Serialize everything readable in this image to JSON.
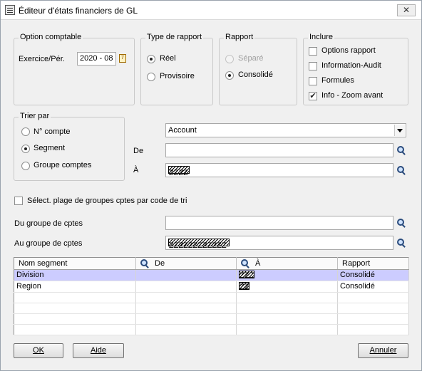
{
  "window": {
    "title": "Éditeur d'états financiers de GL",
    "close_glyph": "✕"
  },
  "option_comptable": {
    "legend": "Option comptable",
    "period_label": "Exercice/Pér.",
    "period_value": "2020 - 08"
  },
  "type_rapport": {
    "legend": "Type de rapport",
    "options": [
      {
        "label": "Réel",
        "checked": true
      },
      {
        "label": "Provisoire",
        "checked": false
      }
    ]
  },
  "rapport": {
    "legend": "Rapport",
    "options": [
      {
        "label": "Séparé",
        "checked": false,
        "disabled": true
      },
      {
        "label": "Consolidé",
        "checked": true,
        "disabled": false
      }
    ]
  },
  "inclure": {
    "legend": "Inclure",
    "options": [
      {
        "label": "Options rapport",
        "checked": false
      },
      {
        "label": "Information-Audit",
        "checked": false
      },
      {
        "label": "Formules",
        "checked": false
      },
      {
        "label": "Info - Zoom avant",
        "checked": true
      }
    ]
  },
  "trier_par": {
    "legend": "Trier par",
    "options": [
      {
        "label": "N° compte",
        "checked": false
      },
      {
        "label": "Segment",
        "checked": true
      },
      {
        "label": "Groupe comptes",
        "checked": false
      }
    ]
  },
  "segment_select": {
    "value": "Account"
  },
  "range": {
    "from_label": "De",
    "from_value": "",
    "to_label": "À",
    "to_value": "ZZZZ"
  },
  "group_sort": {
    "checkbox_label": "Sélect. plage de groupes cptes par code de tri",
    "checked": false,
    "from_label": "Du groupe de cptes",
    "from_value": "",
    "to_label": "Au groupe de cptes",
    "to_value": "ZZZZZZZZZZZZ"
  },
  "segments_table": {
    "columns": [
      "Nom segment",
      "De",
      "À",
      "Rapport"
    ],
    "rows": [
      {
        "name": "Division",
        "from": "",
        "to": "ZZZ",
        "report": "Consolidé",
        "selected": true
      },
      {
        "name": "Region",
        "from": "",
        "to": "ZZ",
        "report": "Consolidé",
        "selected": false
      }
    ],
    "empty_rows": 4
  },
  "buttons": {
    "ok": "OK",
    "aide": "Aide",
    "annuler": "Annuler"
  }
}
